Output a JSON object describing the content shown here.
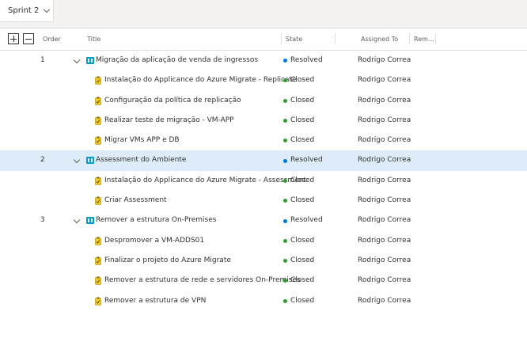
{
  "toolbar": {
    "sprint_label": "Sprint 2"
  },
  "columns": {
    "order": "Order",
    "title": "Title",
    "state": "State",
    "assigned": "Assigned To",
    "remaining": "Rem..."
  },
  "colors": {
    "resolved": "#0078d4",
    "closed": "#339933",
    "selected_row": "#deecf9",
    "story_icon": "#009ccc",
    "task_icon": "#f2cb1d"
  },
  "rows": [
    {
      "order": "1",
      "type": "story",
      "title": "Migração da aplicação de venda de ingressos",
      "state": "Resolved",
      "assigned": "Rodrigo Correa"
    },
    {
      "order": "",
      "type": "task",
      "title": "Instalação do Applicance do Azure Migrate - Replicate",
      "state": "Closed",
      "assigned": "Rodrigo Correa"
    },
    {
      "order": "",
      "type": "task",
      "title": "Configuração da política de replicação",
      "state": "Closed",
      "assigned": "Rodrigo Correa"
    },
    {
      "order": "",
      "type": "task",
      "title": "Realizar teste de migração - VM-APP",
      "state": "Closed",
      "assigned": "Rodrigo Correa"
    },
    {
      "order": "",
      "type": "task",
      "title": "Migrar VMs APP e DB",
      "state": "Closed",
      "assigned": "Rodrigo Correa"
    },
    {
      "order": "2",
      "type": "story",
      "title": "Assessment do Ambiente",
      "state": "Resolved",
      "assigned": "Rodrigo Correa",
      "selected": true
    },
    {
      "order": "",
      "type": "task",
      "title": "Instalação do Applicance do Azure Migrate - Assessment",
      "state": "Closed",
      "assigned": "Rodrigo Correa"
    },
    {
      "order": "",
      "type": "task",
      "title": "Criar Assessment",
      "state": "Closed",
      "assigned": "Rodrigo Correa"
    },
    {
      "order": "3",
      "type": "story",
      "title": "Remover a estrutura On-Premises",
      "state": "Resolved",
      "assigned": "Rodrigo Correa"
    },
    {
      "order": "",
      "type": "task",
      "title": "Despromover a VM-ADDS01",
      "state": "Closed",
      "assigned": "Rodrigo Correa"
    },
    {
      "order": "",
      "type": "task",
      "title": "Finalizar o projeto do Azure Migrate",
      "state": "Closed",
      "assigned": "Rodrigo Correa"
    },
    {
      "order": "",
      "type": "task",
      "title": "Remover a estrutura de rede e servidores On-Premises",
      "state": "Closed",
      "assigned": "Rodrigo Correa"
    },
    {
      "order": "",
      "type": "task",
      "title": "Remover a estrutura de VPN",
      "state": "Closed",
      "assigned": "Rodrigo Correa"
    }
  ]
}
